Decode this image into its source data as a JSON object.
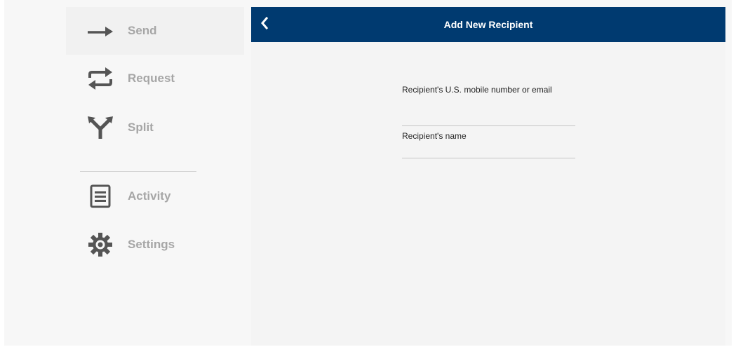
{
  "sidebar": {
    "items": [
      {
        "label": "Send",
        "icon": "arrow-right-icon",
        "active": true
      },
      {
        "label": "Request",
        "icon": "swap-arrows-icon",
        "active": false
      },
      {
        "label": "Split",
        "icon": "split-icon",
        "active": false
      },
      {
        "label": "Activity",
        "icon": "list-icon",
        "active": false
      },
      {
        "label": "Settings",
        "icon": "gear-icon",
        "active": false
      }
    ]
  },
  "header": {
    "title": "Add New Recipient",
    "back_icon": "chevron-left-icon"
  },
  "form": {
    "contact_label": "Recipient's U.S. mobile number or email",
    "name_label": "Recipient's name"
  },
  "colors": {
    "header_bg": "#003a70",
    "nav_text": "#a6a6a6",
    "icon": "#555555"
  }
}
